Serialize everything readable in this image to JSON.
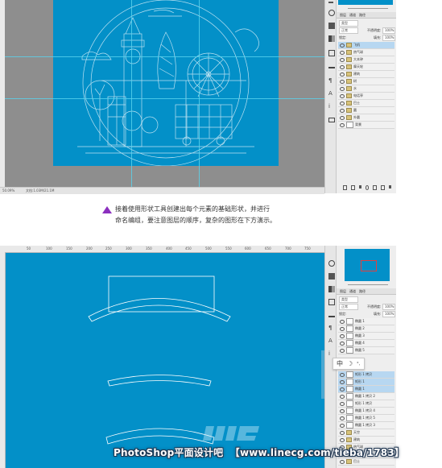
{
  "screen1": {
    "status": {
      "zoom": "50.09%",
      "doc": "文档:1.03M/21.1M"
    },
    "panel": {
      "tabs": [
        "图层",
        "通道",
        "路径"
      ],
      "kind_label": "类型",
      "mode_value": "正常",
      "opacity_label": "不透明度:",
      "opacity_value": "100%",
      "lock_label": "锁定:",
      "fill_label": "填充:",
      "fill_value": "100%",
      "layers": [
        "飞机",
        "热气球",
        "大本钟",
        "摩天轮",
        "建筑",
        "树",
        "水",
        "电话亭",
        "巴士",
        "圆",
        "外圆",
        "背景"
      ]
    }
  },
  "caption": {
    "line1": "接着使用形状工具创建出每个元素的基础形状，并进行",
    "line2": "命名编组，要注意图层的顺序，复杂的图形在下方演示。"
  },
  "screen2": {
    "ruler_ticks": [
      "50",
      "100",
      "150",
      "200",
      "250",
      "300",
      "350",
      "400",
      "450",
      "500",
      "550",
      "600",
      "650",
      "700",
      "750"
    ],
    "panel": {
      "tabs": [
        "图层",
        "通道",
        "路径"
      ],
      "kind_label": "类型",
      "mode_value": "正常",
      "opacity_label": "不透明度:",
      "opacity_value": "100%",
      "lock_label": "锁定:",
      "fill_label": "填充:",
      "fill_value": "100%",
      "layers_top": [
        "椭圆 1",
        "椭圆 2",
        "椭圆 3",
        "椭圆 4",
        "椭圆 5"
      ],
      "layers_sel": [
        "矩形 1 拷贝",
        "矩形 1",
        "椭圆 1"
      ],
      "layers_bottom": [
        "椭圆 1 拷贝 2",
        "矩形 1 拷贝",
        "椭圆 1 拷贝 4",
        "椭圆 1 拷贝 5",
        "椭圆 1 拷贝 3"
      ],
      "groups": [
        "天空",
        "建筑",
        "热气球",
        "电话亭",
        "巴士"
      ]
    },
    "ime_popup": {
      "char": "中",
      "moon": "☽",
      "extra": "°,"
    }
  },
  "footer": {
    "brand": "PhotoShop平面设计吧",
    "url": "【www.linecg.com/tieba/1783】"
  },
  "colors": {
    "canvas_blue": "#0390c8",
    "guide": "#5ad4ef",
    "caption_icon": "#8b2fbe"
  }
}
